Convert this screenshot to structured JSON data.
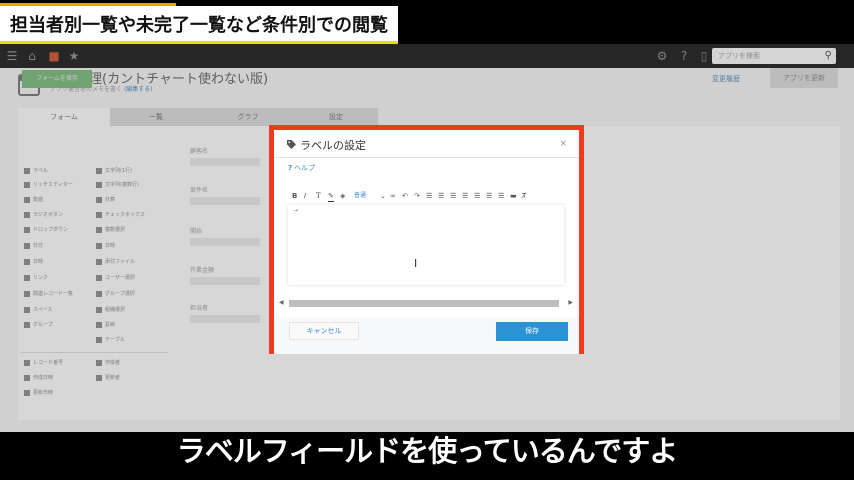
{
  "banner": {
    "text": "担当者別一覧や未完了一覧など条件別での閲覧"
  },
  "topbar": {
    "search_placeholder": "アプリを検索"
  },
  "app": {
    "title": "工程管理(カントチャート使わない版)",
    "sub_text": "アプリ運営者のメモを書く",
    "sub_link": "(編集する)",
    "change_history": "変更履歴",
    "settings_button": "アプリを更新",
    "tabs": [
      "フォーム",
      "一覧",
      "グラフ",
      "設定"
    ],
    "form_button": "フォームを保存",
    "palette_left": [
      "ラベル",
      "リッチエディター",
      "数値",
      "ラジオボタン",
      "ドロップダウン",
      "日付",
      "日時",
      "リンク",
      "関連レコード一覧",
      "スペース",
      "グループ"
    ],
    "palette_right": [
      "文字列(1行)",
      "文字列(複数行)",
      "計算",
      "チェックボックス",
      "複数選択",
      "日時",
      "添付ファイル",
      "ユーザー選択",
      "グループ選択",
      "組織選択",
      "罫線",
      "テーブル"
    ],
    "palette_bottom_left": [
      "レコード番号",
      "作成日時",
      "更新日時"
    ],
    "palette_bottom_right": [
      "作成者",
      "更新者"
    ],
    "field_labels": [
      "顧客名",
      "案件名",
      "開始",
      "作業金額",
      "担当者"
    ]
  },
  "dialog": {
    "title": "ラベルの設定",
    "help": "ヘルプ",
    "help_prefix": "?",
    "font_size_label": "普通",
    "editor_mark": "→",
    "cancel": "キャンセル",
    "save": "保存",
    "close": "×"
  },
  "subtitle": {
    "text": "ラベルフィールドを使っているんですよ"
  },
  "colors": {
    "dialog_border": "#ef3a21",
    "save_button": "#2b93d5",
    "link": "#3c8dc5"
  }
}
